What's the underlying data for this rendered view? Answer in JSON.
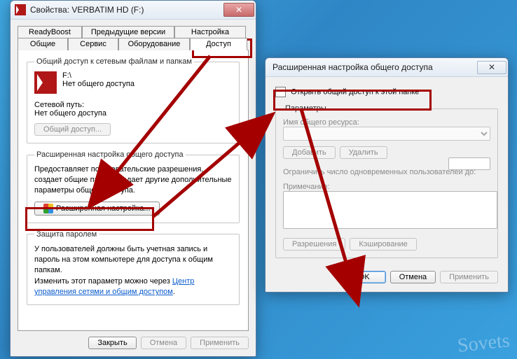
{
  "win1": {
    "title": "Свойства: VERBATIM HD (F:)",
    "tabs_top": [
      "ReadyBoost",
      "Предыдущие версии",
      "Настройка"
    ],
    "tabs_bottom": [
      "Общие",
      "Сервис",
      "Оборудование",
      "Доступ"
    ],
    "active_tab": "Доступ",
    "share_group": {
      "legend": "Общий доступ к сетевым файлам и папкам",
      "drive_path": "F:\\",
      "status": "Нет общего доступа",
      "netpath_label": "Сетевой путь:",
      "netpath_value": "Нет общего доступа",
      "share_btn": "Общий доступ..."
    },
    "advanced_group": {
      "legend": "Расширенная настройка общего доступа",
      "desc": "Предоставляет пользовательские разрешения, создает общие папки и задает другие дополнительные параметры общего доступа.",
      "btn": "Расширенная настройка..."
    },
    "protect_group": {
      "legend": "Защита паролем",
      "desc_prefix": "У пользователей должны быть учетная запись и пароль на этом компьютере для доступа к общим папкам.\nИзменить этот параметр можно через ",
      "link": "Центр управления сетями и общим доступом",
      "desc_suffix": "."
    },
    "footer": {
      "close": "Закрыть",
      "cancel": "Отмена",
      "apply": "Применить"
    }
  },
  "win2": {
    "title": "Расширенная настройка общего доступа",
    "open_share_label": "Открыть общий доступ к этой папке",
    "params_legend": "Параметры",
    "resource_name_label": "Имя общего ресурса:",
    "resource_name_value": "",
    "add_btn": "Добавить",
    "remove_btn": "Удалить",
    "limit_label": "Ограничить число одновременных пользователей до:",
    "limit_value": "",
    "note_label": "Примечание:",
    "note_value": "",
    "perm_btn": "Разрешения",
    "cache_btn": "Кэширование",
    "ok": "OK",
    "cancel": "Отмена",
    "apply": "Применить"
  },
  "watermark": "Sovets"
}
